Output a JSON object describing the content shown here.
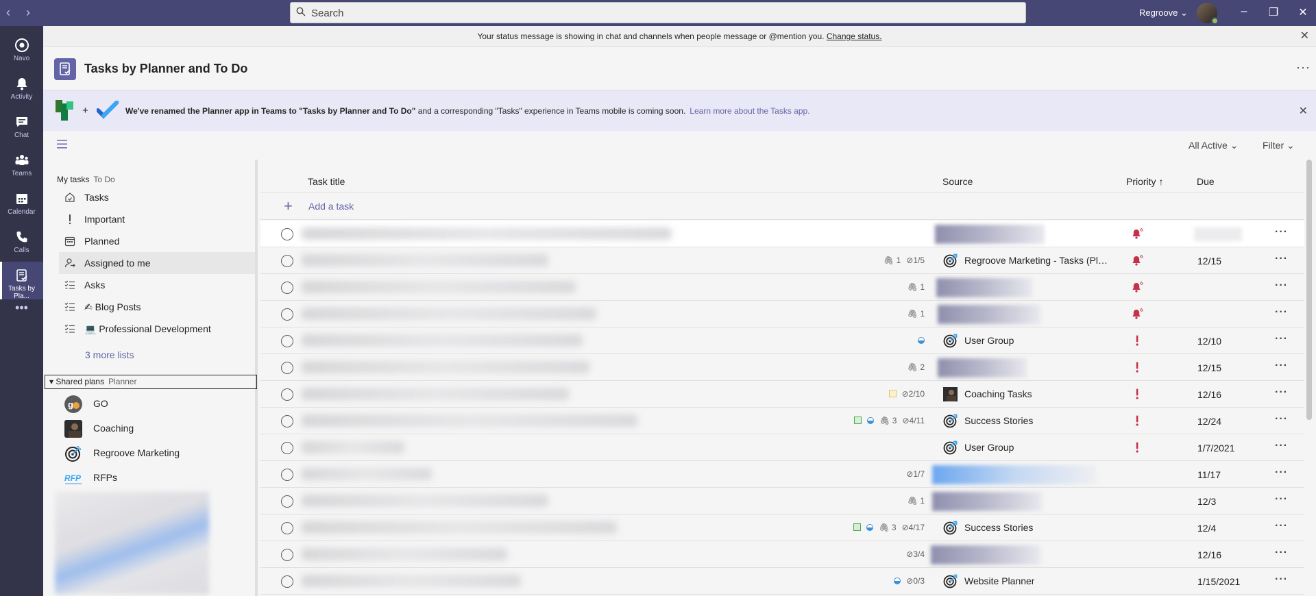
{
  "titlebar": {
    "search_placeholder": "Search",
    "tenant": "Regroove ⌄"
  },
  "rail": [
    {
      "label": "Navo",
      "icon": "navo-icon"
    },
    {
      "label": "Activity",
      "icon": "bell-icon"
    },
    {
      "label": "Chat",
      "icon": "chat-icon"
    },
    {
      "label": "Teams",
      "icon": "teams-icon"
    },
    {
      "label": "Calendar",
      "icon": "calendar-icon"
    },
    {
      "label": "Calls",
      "icon": "phone-icon"
    },
    {
      "label": "Tasks by Pla...",
      "icon": "tasks-icon"
    }
  ],
  "status_bar": {
    "text": "Your status message is showing in chat and channels when people message or @mention you.",
    "link": "Change status."
  },
  "app": {
    "title": "Tasks by Planner and To Do"
  },
  "banner": {
    "bold": "We've renamed the Planner app in Teams to \"Tasks by Planner and To Do\"",
    "rest": " and a corresponding \"Tasks\" experience in Teams mobile is coming soon.",
    "link": "Learn more about the Tasks app."
  },
  "toolbar": {
    "all_active": "All Active ⌄",
    "filter": "Filter ⌄"
  },
  "side": {
    "my_tasks": "My tasks",
    "my_tasks_sub": "To Do",
    "lists": [
      {
        "label": "Tasks",
        "icon": "home-check-icon"
      },
      {
        "label": "Important",
        "icon": "exclamation-icon"
      },
      {
        "label": "Planned",
        "icon": "calendar-grid-icon"
      },
      {
        "label": "Assigned to me",
        "icon": "person-icon"
      },
      {
        "label": "Asks",
        "icon": "checklist-icon"
      },
      {
        "label": "✍ Blog Posts",
        "icon": "checklist-icon"
      },
      {
        "label": "💻 Professional Development",
        "icon": "checklist-icon"
      }
    ],
    "more_lists": "3 more lists",
    "shared_plans": "Shared plans",
    "shared_plans_sub": "Planner",
    "plans": [
      {
        "label": "GO",
        "icon": "go-avatar-icon"
      },
      {
        "label": "Coaching",
        "icon": "coaching-avatar-icon"
      },
      {
        "label": "Regroove Marketing",
        "icon": "target-icon"
      },
      {
        "label": "RFPs",
        "icon": "rfp-logo-icon"
      }
    ]
  },
  "columns": {
    "title": "Task title",
    "source": "Source",
    "priority": "Priority ↑",
    "due": "Due"
  },
  "add_task": "Add a task",
  "colors": {
    "accent": "#6264a7",
    "urgent": "#c4314b",
    "rail": "#33344a",
    "titlebar": "#464775"
  },
  "tasks": [
    {
      "meta": [],
      "source": "",
      "priority": "urgent",
      "due": ""
    },
    {
      "meta": [
        {
          "t": "attach",
          "v": "1"
        },
        {
          "t": "check",
          "v": "1/5"
        }
      ],
      "source": "Regroove Marketing - Tasks (Pla...",
      "priority": "urgent",
      "due": "12/15"
    },
    {
      "meta": [
        {
          "t": "attach",
          "v": "1"
        }
      ],
      "source": "",
      "priority": "urgent",
      "due": ""
    },
    {
      "meta": [
        {
          "t": "attach",
          "v": "1"
        }
      ],
      "source": "",
      "priority": "urgent",
      "due": ""
    },
    {
      "meta": [
        {
          "t": "progress",
          "v": ""
        }
      ],
      "source": "User Group",
      "priority": "important",
      "due": "12/10"
    },
    {
      "meta": [
        {
          "t": "attach",
          "v": "2"
        }
      ],
      "source": "",
      "priority": "important",
      "due": "12/15"
    },
    {
      "meta": [
        {
          "t": "label",
          "v": ""
        },
        {
          "t": "check",
          "v": "2/10"
        }
      ],
      "source": "Coaching Tasks",
      "priority": "important",
      "due": "12/16"
    },
    {
      "meta": [
        {
          "t": "label",
          "v": ""
        },
        {
          "t": "progress",
          "v": ""
        },
        {
          "t": "attach",
          "v": "3"
        },
        {
          "t": "check",
          "v": "4/11"
        }
      ],
      "source": "Success Stories",
      "priority": "important",
      "due": "12/24"
    },
    {
      "meta": [],
      "source": "User Group",
      "priority": "important",
      "due": "1/7/2021"
    },
    {
      "meta": [
        {
          "t": "check",
          "v": "1/7"
        }
      ],
      "source": "",
      "priority": "",
      "due": "11/17"
    },
    {
      "meta": [
        {
          "t": "attach",
          "v": "1"
        }
      ],
      "source": "",
      "priority": "",
      "due": "12/3"
    },
    {
      "meta": [
        {
          "t": "label",
          "v": ""
        },
        {
          "t": "progress",
          "v": ""
        },
        {
          "t": "attach",
          "v": "3"
        },
        {
          "t": "check",
          "v": "4/17"
        }
      ],
      "source": "Success Stories",
      "priority": "",
      "due": "12/4"
    },
    {
      "meta": [
        {
          "t": "check",
          "v": "3/4"
        }
      ],
      "source": "",
      "priority": "",
      "due": "12/16"
    },
    {
      "meta": [
        {
          "t": "progress",
          "v": ""
        },
        {
          "t": "check",
          "v": "0/3"
        }
      ],
      "source": "Website Planner",
      "priority": "",
      "due": "1/15/2021"
    }
  ]
}
